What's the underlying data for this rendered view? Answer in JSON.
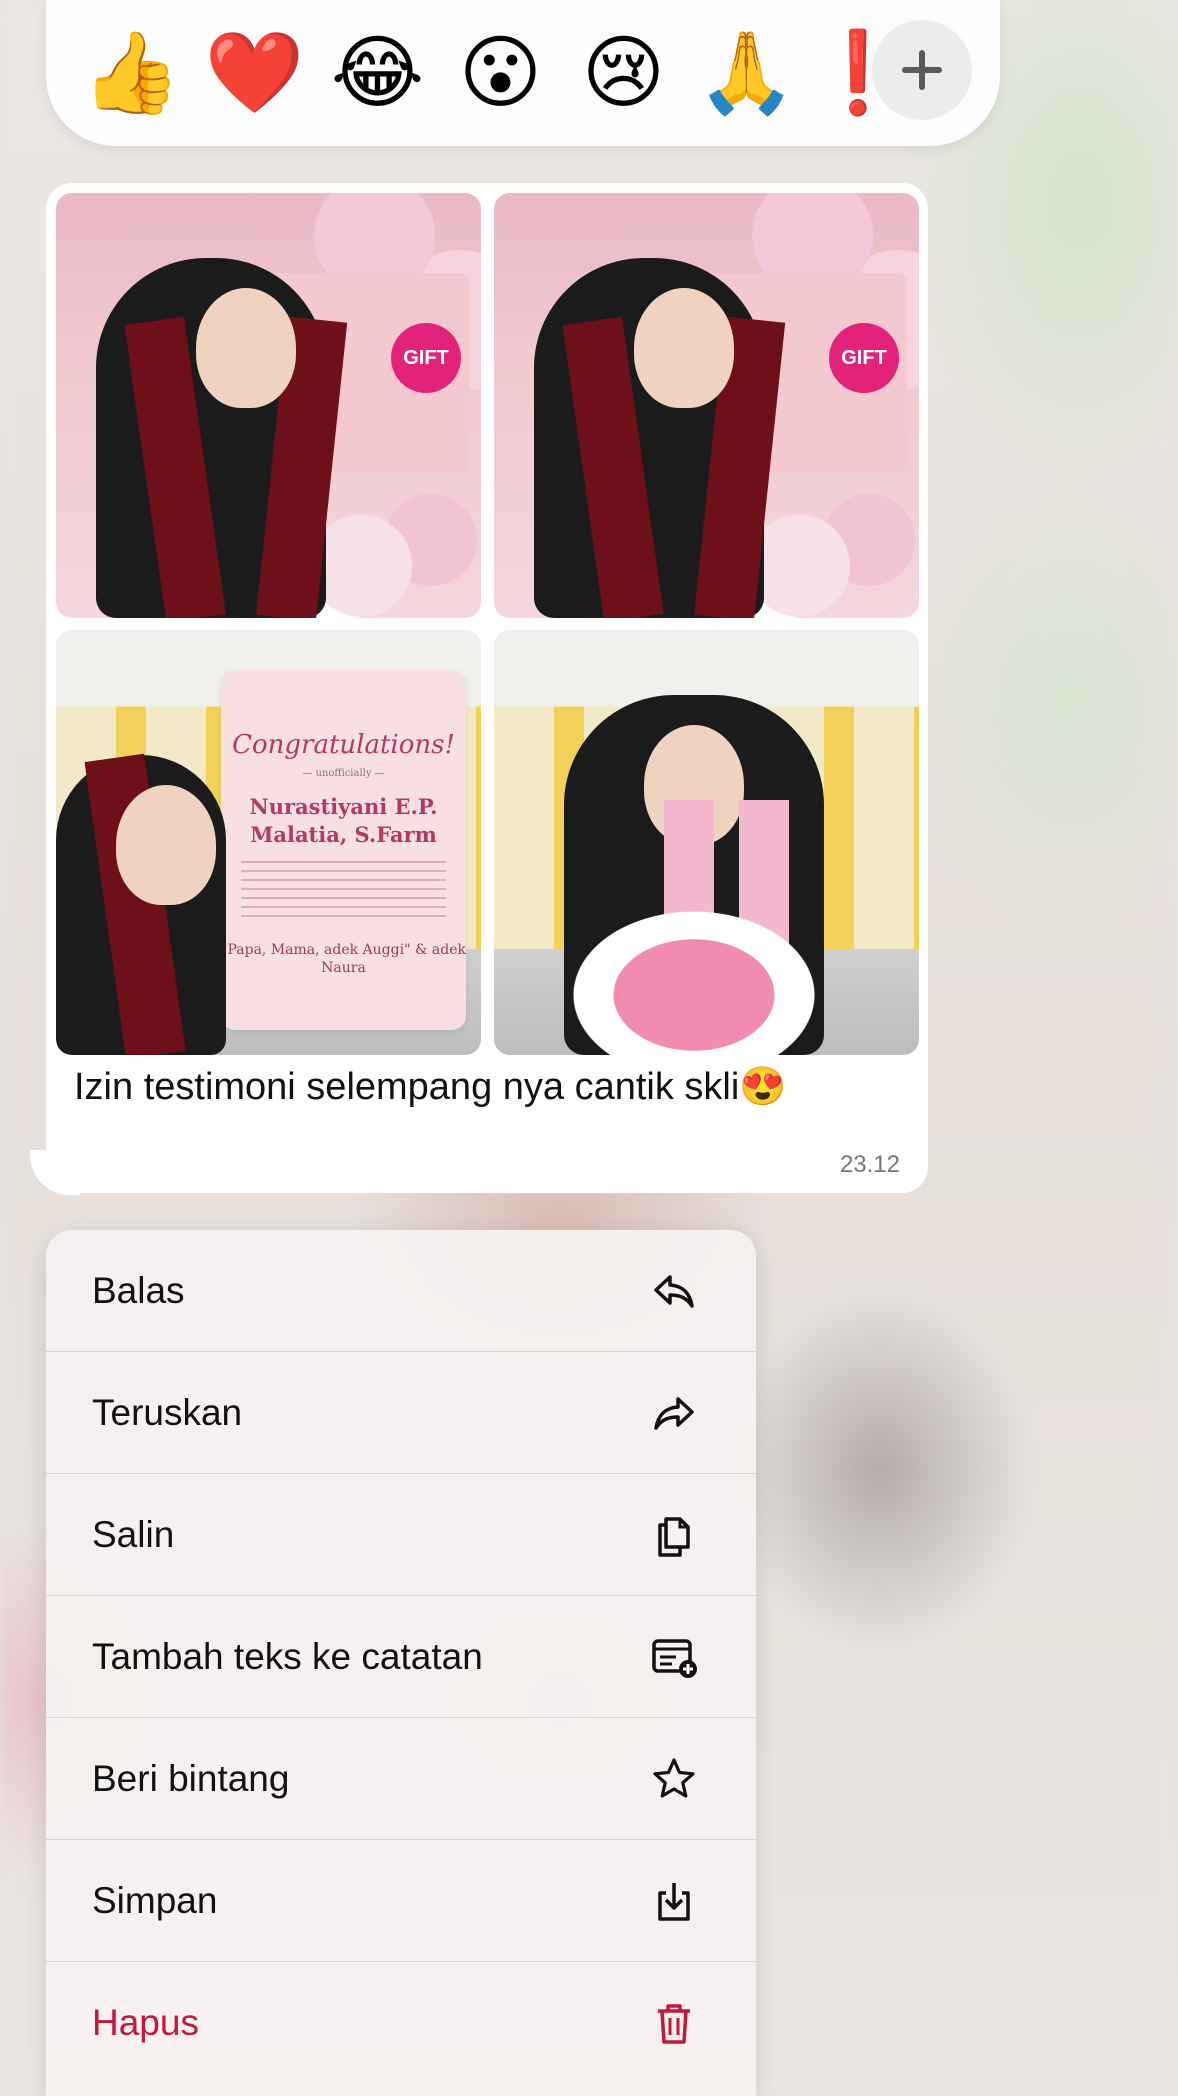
{
  "reactions": {
    "emojis": [
      "👍",
      "❤️",
      "😂",
      "😮",
      "😢",
      "🙏",
      "❗"
    ],
    "more_label": "+"
  },
  "message": {
    "photo_texts": {
      "gift_tag": "GIFT",
      "card_title": "Congratulations!",
      "card_subtitle": "— unofficially —",
      "card_name": "Nurastiyani E.P. Malatia, S.Farm",
      "card_from": "\"Papa, Mama, adek Auggi\" & adek Naura"
    },
    "text": "Izin testimoni selempang nya cantik skli😍",
    "time": "23.12"
  },
  "menu": {
    "items": [
      {
        "label": "Balas",
        "icon": "reply-icon"
      },
      {
        "label": "Teruskan",
        "icon": "forward-icon"
      },
      {
        "label": "Salin",
        "icon": "copy-icon"
      },
      {
        "label": "Tambah teks ke catatan",
        "icon": "add-note-icon"
      },
      {
        "label": "Beri bintang",
        "icon": "star-icon"
      },
      {
        "label": "Simpan",
        "icon": "save-icon"
      },
      {
        "label": "Hapus",
        "icon": "trash-icon",
        "danger": true
      }
    ],
    "danger_color": "#c0193a"
  }
}
